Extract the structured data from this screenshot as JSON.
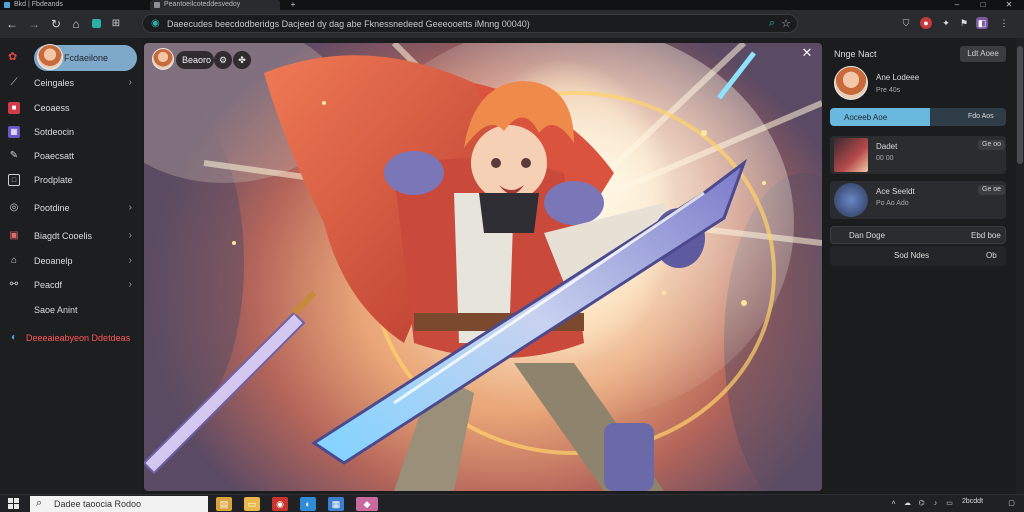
{
  "browser": {
    "tabs": [
      {
        "label": "Bkd | Fbdeands",
        "active": false
      },
      {
        "label": "Peantoeilcoteddesvedoy",
        "active": true
      }
    ],
    "new_tab": "+",
    "window_controls": {
      "minimize": "–",
      "maximize": "□",
      "close": "✕"
    },
    "nav": {
      "back": "←",
      "forward": "→",
      "reload": "↻",
      "home": "⌂"
    },
    "address": "Daeecudes beecdodberidgs Dacjeed dy dag abe Fknessnedeed Geeeooetts iMnng 00040)",
    "toolbar_icons": [
      "search-icon",
      "star-icon"
    ],
    "extensions": [
      "shield-icon",
      "record-icon",
      "puzzle-icon",
      "flag-icon",
      "profile-icon"
    ]
  },
  "sidebar": {
    "profile_name": "Fcdaeilone",
    "items": [
      {
        "label": "Ceingales",
        "icon": "diamond-icon",
        "chevron": true
      },
      {
        "label": "Ceoaess",
        "icon": "red-square-icon",
        "chevron": false
      },
      {
        "label": "Sotdeocin",
        "icon": "purple-square-icon",
        "chevron": false
      },
      {
        "label": "Poaecsatt",
        "icon": "pencil-icon",
        "chevron": false
      },
      {
        "label": "Prodplate",
        "icon": "frame-icon",
        "chevron": false
      },
      {
        "label": "Pootdine",
        "icon": "circle-icon",
        "chevron": true
      },
      {
        "label": "Biagdt Cooelis",
        "icon": "book-icon",
        "chevron": true
      },
      {
        "label": "Deoanelp",
        "icon": "house-icon",
        "chevron": true
      },
      {
        "label": "Peacdf",
        "icon": "share-icon",
        "chevron": true
      },
      {
        "label": "Saoe Anint",
        "icon": "",
        "chevron": false
      }
    ],
    "footer_link": "Deeeaieabyeon Ddetdeas"
  },
  "viewer": {
    "author": "Beaoro",
    "close": "✕"
  },
  "rpanel": {
    "header": "Nnge Nact",
    "header_button": "Ldt Aoee",
    "profile": {
      "name": "Ane Lodeee",
      "meta": "Pre 40s"
    },
    "progress": {
      "label": "Aoceeb Aoe",
      "value_text": "Fdo Aos",
      "fraction": 0.57
    },
    "cards": [
      {
        "title": "Dadet",
        "meta": "00 00",
        "badge": "Ge oo"
      },
      {
        "title": "Ace Seeldt",
        "meta": "Po Ao Ado",
        "badge": "Ge oe"
      }
    ],
    "row": {
      "left": "Dan Doge",
      "right": "Ebd boe"
    },
    "footer": {
      "left": "Sod Ndes",
      "right": "Ob"
    }
  },
  "taskbar": {
    "search_placeholder": "Dadee taoocia Rodoo",
    "apps": [
      "file-icon",
      "folder-icon",
      "app-icon",
      "edge-icon",
      "store-icon",
      "pink-icon"
    ],
    "tray_time": "2bcddt"
  },
  "colors": {
    "accent_teal": "#2bb0a8",
    "pill_blue": "#7fa9c9",
    "progress_blue": "#69b8dd",
    "footer_link_red": "#ff5757"
  }
}
